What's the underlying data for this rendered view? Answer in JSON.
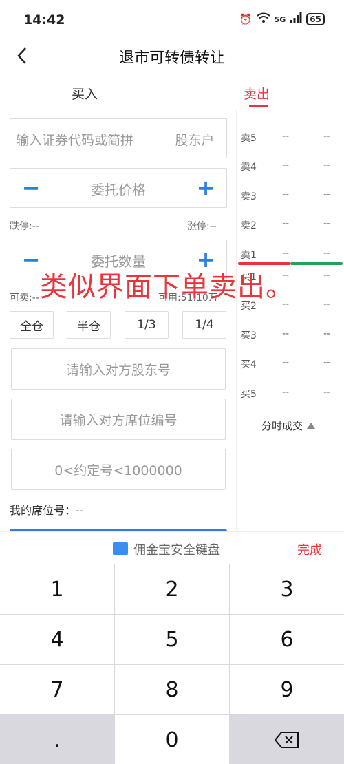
{
  "status_bar": {
    "time": "14:42",
    "network": "5G",
    "battery": "65"
  },
  "header": {
    "title": "退市可转债转让"
  },
  "tabs": {
    "buy": "买入",
    "sell": "卖出"
  },
  "form": {
    "code_placeholder": "输入证券代码或简拼",
    "shareholder_account": "股东户",
    "price_placeholder": "委托价格",
    "limit_down": "跌停:--",
    "limit_up": "涨停:--",
    "quantity_placeholder": "委托数量",
    "sellable": "可卖:--",
    "available": "可用:51.10万",
    "position_buttons": [
      "全仓",
      "半仓",
      "1/3",
      "1/4"
    ],
    "counterparty_account_placeholder": "请输入对方股东号",
    "counterparty_seat_placeholder": "请输入对方席位编号",
    "agreement_placeholder": "0<约定号<1000000",
    "my_seat_label": "我的席位号：",
    "my_seat_value": "--"
  },
  "order_book": {
    "sell": [
      {
        "label": "卖5",
        "price": "--",
        "volume": "--"
      },
      {
        "label": "卖4",
        "price": "--",
        "volume": "--"
      },
      {
        "label": "卖3",
        "price": "--",
        "volume": "--"
      },
      {
        "label": "卖2",
        "price": "--",
        "volume": "--"
      },
      {
        "label": "卖1",
        "price": "--",
        "volume": "--"
      }
    ],
    "buy": [
      {
        "label": "买1",
        "price": "--",
        "volume": "--"
      },
      {
        "label": "买2",
        "price": "--",
        "volume": "--"
      },
      {
        "label": "买3",
        "price": "--",
        "volume": "--"
      },
      {
        "label": "买4",
        "price": "--",
        "volume": "--"
      },
      {
        "label": "买5",
        "price": "--",
        "volume": "--"
      }
    ],
    "tick_toggle": "分时成交"
  },
  "annotation": "类似界面下单卖出。",
  "keyboard": {
    "title": "佣金宝安全键盘",
    "done": "完成",
    "keys": [
      "1",
      "2",
      "3",
      "4",
      "5",
      "6",
      "7",
      "8",
      "9",
      ".",
      "0"
    ]
  },
  "colors": {
    "accent_red": "#e8343a",
    "accent_blue": "#2e7de6",
    "accent_green": "#22a35a"
  }
}
